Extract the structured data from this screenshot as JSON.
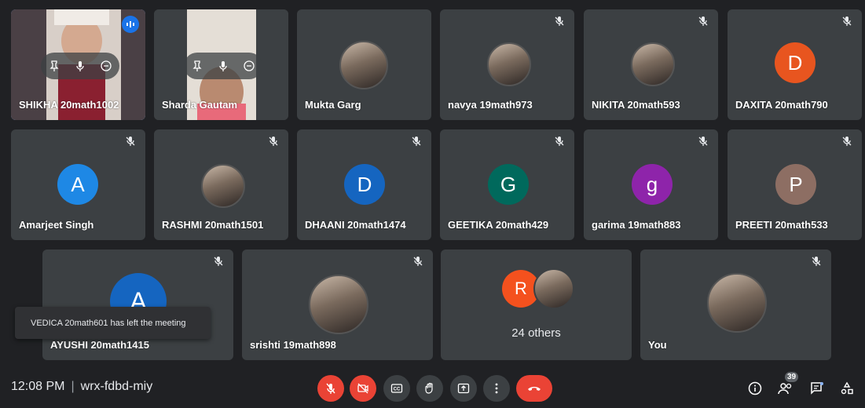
{
  "tiles": [
    {
      "name": "SHIKHA 20math1002"
    },
    {
      "name": "Sharda Gautam"
    },
    {
      "name": "Mukta Garg"
    },
    {
      "name": "navya 19math973"
    },
    {
      "name": "NIKITA 20math593"
    },
    {
      "name": "DAXITA 20math790",
      "initial": "D",
      "color": "#e8551f"
    },
    {
      "name": "Amarjeet Singh",
      "initial": "A",
      "color": "#1e88e5"
    },
    {
      "name": "RASHMI 20math1501"
    },
    {
      "name": "DHAANI 20math1474",
      "initial": "D",
      "color": "#1565c0"
    },
    {
      "name": "GEETIKA 20math429",
      "initial": "G",
      "color": "#00695c"
    },
    {
      "name": "garima 19math883",
      "initial": "g",
      "color": "#8e24aa"
    },
    {
      "name": "PREETI 20math533",
      "initial": "P",
      "color": "#8d6e63"
    },
    {
      "name": "AYUSHI 20math1415",
      "initial": "A",
      "color": "#1565c0"
    },
    {
      "name": "srishti 19math898"
    },
    {
      "name": "24 others",
      "initial": "R",
      "color": "#f4511e"
    },
    {
      "name": "You"
    }
  ],
  "toast": "VEDICA 20math601 has left the meeting",
  "bottom_bar": {
    "time": "12:08 PM",
    "separator": "|",
    "meeting_code": "wrx-fdbd-miy",
    "participant_count": "39"
  },
  "icons": {
    "mic": "mic-off-icon",
    "camera": "camera-off-icon",
    "captions": "captions-icon",
    "hand": "raise-hand-icon",
    "present": "present-icon",
    "more": "more-options-icon",
    "leave": "leave-call-icon",
    "info": "info-icon",
    "people": "people-icon",
    "chat": "chat-icon",
    "activities": "activities-icon"
  }
}
